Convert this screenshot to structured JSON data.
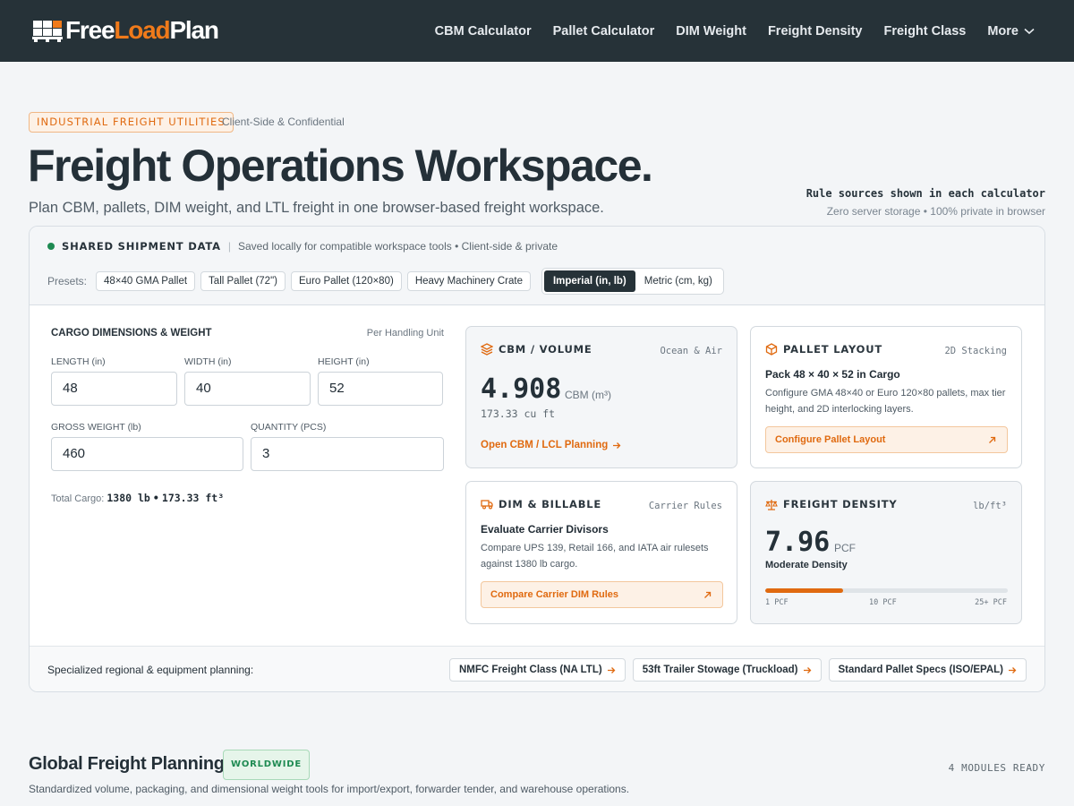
{
  "header": {
    "logo": {
      "part1": "Free",
      "part2": "Load",
      "part3": "Plan"
    },
    "nav": [
      "CBM Calculator",
      "Pallet Calculator",
      "DIM Weight",
      "Freight Density",
      "Freight Class"
    ],
    "more_label": "More"
  },
  "hero": {
    "tag": "INDUSTRIAL FREIGHT UTILITIES",
    "tag_sub": "Client-Side & Confidential",
    "title": "Freight Operations Workspace.",
    "subtitle": "Plan CBM, pallets, DIM weight, and LTL freight in one browser-based freight workspace.",
    "rule_sources": "Rule sources shown in each calculator",
    "privacy": "Zero server storage • 100% private in browser"
  },
  "shared": {
    "label": "SHARED SHIPMENT DATA",
    "divider": "|",
    "desc": "Saved locally for compatible workspace tools • Client-side & private",
    "presets_label": "Presets:",
    "presets": [
      "48×40 GMA Pallet",
      "Tall Pallet (72\")",
      "Euro Pallet (120×80)",
      "Heavy Machinery Crate"
    ],
    "units": [
      "Imperial (in, lb)",
      "Metric (cm, kg)"
    ]
  },
  "cargo": {
    "title": "CARGO DIMENSIONS & WEIGHT",
    "note": "Per Handling Unit",
    "length_label": "LENGTH (in)",
    "length": "48",
    "width_label": "WIDTH (in)",
    "width": "40",
    "height_label": "HEIGHT (in)",
    "height": "52",
    "weight_label": "GROSS WEIGHT (lb)",
    "weight": "460",
    "qty_label": "QUANTITY (PCS)",
    "qty": "3",
    "total_label": "Total Cargo:",
    "total_weight": "1380 lb",
    "total_sep": "•",
    "total_volume": "173.33 ft³"
  },
  "cbm_card": {
    "title": "CBM / VOLUME",
    "tag": "Ocean & Air",
    "value": "4.908",
    "unit": "CBM (m³)",
    "cuft": "173.33 cu ft",
    "link": "Open CBM / LCL Planning"
  },
  "pallet_card": {
    "title": "PALLET LAYOUT",
    "tag": "2D Stacking",
    "heading": "Pack 48 × 40 × 52 in Cargo",
    "desc": "Configure GMA 48×40 or Euro 120×80 pallets, max tier height, and 2D interlocking layers.",
    "cta": "Configure Pallet Layout"
  },
  "dim_card": {
    "title": "DIM & BILLABLE",
    "tag": "Carrier Rules",
    "heading": "Evaluate Carrier Divisors",
    "desc": "Compare UPS 139, Retail 166, and IATA air rulesets against 1380 lb cargo.",
    "cta": "Compare Carrier DIM Rules"
  },
  "density_card": {
    "title": "FREIGHT DENSITY",
    "tag": "lb/ft³",
    "value": "7.96",
    "unit": "PCF",
    "label": "Moderate Density",
    "fill_fraction": 0.32,
    "ticks": [
      "1 PCF",
      "10 PCF",
      "25+ PCF"
    ]
  },
  "footer_panel": {
    "label": "Specialized regional & equipment planning:",
    "links": [
      "NMFC Freight Class (NA LTL)",
      "53ft Trailer Stowage (Truckload)",
      "Standard Pallet Specs (ISO/EPAL)"
    ]
  },
  "global": {
    "title": "Global Freight Planning",
    "badge": "WORLDWIDE",
    "ready": "4 MODULES READY",
    "subtitle": "Standardized volume, packaging, and dimensional weight tools for import/export, forwarder tender, and warehouse operations."
  },
  "colors": {
    "accent": "#e06a10",
    "header_bg": "#263238",
    "success": "#1e8a52"
  }
}
